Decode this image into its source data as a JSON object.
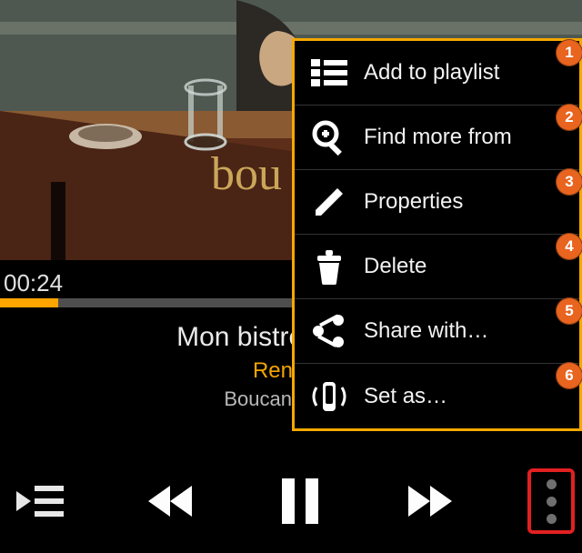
{
  "player": {
    "elapsed": "00:24",
    "progress_percent": 10,
    "track_title": "Mon bistrot préféré",
    "artist": "Renaud",
    "album": "Boucan d'enfer"
  },
  "art": {
    "text_overlay": "bou"
  },
  "menu": {
    "items": [
      {
        "label": "Add to playlist",
        "badge": "1"
      },
      {
        "label": "Find more from",
        "badge": "2"
      },
      {
        "label": "Properties",
        "badge": "3"
      },
      {
        "label": "Delete",
        "badge": "4"
      },
      {
        "label": "Share with…",
        "badge": "5"
      },
      {
        "label": "Set as…",
        "badge": "6"
      }
    ]
  },
  "colors": {
    "accent": "#f6a800",
    "badge": "#e8641f"
  }
}
